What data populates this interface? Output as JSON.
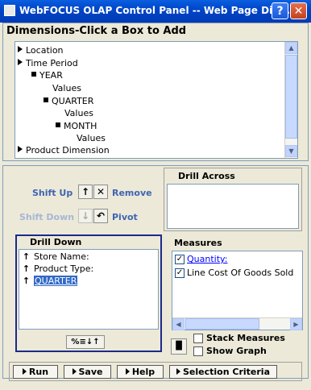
{
  "window": {
    "title": "WebFOCUS OLAP Control Panel -- Web Page Dia...",
    "help_label": "?",
    "close_label": "✕"
  },
  "dimensions": {
    "header": "Dimensions-Click a Box to Add",
    "tree": [
      {
        "label": "Location",
        "kind": "expand"
      },
      {
        "label": "Time Period",
        "kind": "expand"
      },
      {
        "label": "YEAR",
        "kind": "node"
      },
      {
        "label": "Values",
        "kind": "leaf"
      },
      {
        "label": "QUARTER",
        "kind": "node"
      },
      {
        "label": "Values",
        "kind": "leaf"
      },
      {
        "label": "MONTH",
        "kind": "node"
      },
      {
        "label": "Values",
        "kind": "leaf"
      },
      {
        "label": "Product Dimension",
        "kind": "expand"
      }
    ]
  },
  "controls": {
    "shift_up": "Shift Up",
    "remove": "Remove",
    "shift_down": "Shift Down",
    "pivot": "Pivot",
    "up_glyph": "↑",
    "remove_glyph": "✕",
    "down_glyph": "↓",
    "pivot_glyph": "↶"
  },
  "drill_across": {
    "header": "Drill Across"
  },
  "drill_down": {
    "header": "Drill Down",
    "items": [
      "Store Name:",
      "Product Type:",
      "QUARTER"
    ],
    "sort_label": "%≡↓↑"
  },
  "measures": {
    "header": "Measures",
    "items": [
      {
        "label": "Quantity:",
        "checked": true
      },
      {
        "label": "Line Cost Of Goods Sold",
        "checked": true
      }
    ],
    "stack_label": "Stack Measures",
    "graph_label": "Show Graph"
  },
  "buttons": {
    "run": "Run",
    "save": "Save",
    "help": "Help",
    "selection": "Selection Criteria"
  },
  "colors": {
    "titlebar": "#0046c8",
    "selection": "#3169c6",
    "link": "#0000ff",
    "panel_border": "#7f9db9"
  }
}
